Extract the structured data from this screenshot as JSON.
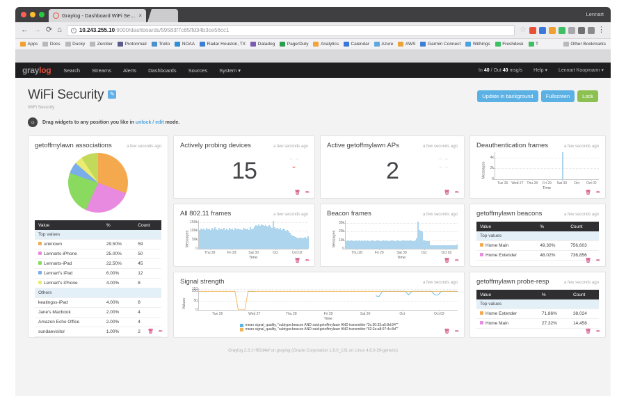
{
  "window": {
    "user": "Lennart"
  },
  "browser": {
    "tab_title": "Graylog - Dashboard WiFi Sec…",
    "tab_close": "×",
    "url_host": "10.243.255.10",
    "url_path": ":9000/dashboards/59583f7c85ffd34b3ce56cc1",
    "back_icon": "←",
    "fwd_icon": "→",
    "reload_icon": "⟳",
    "home_icon": "⌂",
    "star_icon": "☆",
    "menu_icon": "⋮",
    "bookmarks": [
      {
        "label": "Apps",
        "icon": "apps-grid-icon",
        "color": "#f0a030"
      },
      {
        "label": "Docs",
        "icon": "folder-icon",
        "color": "#b9b8bb"
      },
      {
        "label": "Ducky",
        "icon": "folder-icon",
        "color": "#b9b8bb"
      },
      {
        "label": "Zerotier",
        "icon": "folder-icon",
        "color": "#b9b8bb"
      },
      {
        "label": "Protonmail",
        "icon": "lock-icon",
        "color": "#5b5b8c"
      },
      {
        "label": "Trello",
        "icon": "trello-icon",
        "color": "#4c8fce"
      },
      {
        "label": "NOAA",
        "icon": "globe-icon",
        "color": "#2e8fd4"
      },
      {
        "label": "Radar Houston, TX",
        "icon": "radar-icon",
        "color": "#3d7fd0"
      },
      {
        "label": "Datadog",
        "icon": "datadog-icon",
        "color": "#7a5cb0"
      },
      {
        "label": "PagerDuty",
        "icon": "pagerduty-icon",
        "color": "#2a9d4e"
      },
      {
        "label": "Analytics",
        "icon": "analytics-icon",
        "color": "#f2a33c"
      },
      {
        "label": "Calendar",
        "icon": "calendar-icon",
        "color": "#3a78d8"
      },
      {
        "label": "Azure",
        "icon": "cloud-icon",
        "color": "#5fa8dd"
      },
      {
        "label": "AWS",
        "icon": "aws-icon",
        "color": "#e8a33d"
      },
      {
        "label": "Garmin Connect",
        "icon": "triangle-icon",
        "color": "#3d7fd0"
      },
      {
        "label": "Withings",
        "icon": "withings-icon",
        "color": "#4aa3e0"
      },
      {
        "label": "Freshdesk",
        "icon": "freshdesk-icon",
        "color": "#3fbf63"
      },
      {
        "label": "T",
        "icon": "square-icon",
        "color": "#3fbf63"
      }
    ],
    "other_bookmarks": "Other Bookmarks"
  },
  "graylog_nav": {
    "logo_part1": "gray",
    "logo_part2": "log",
    "items": [
      "Search",
      "Streams",
      "Alerts",
      "Dashboards",
      "Sources",
      "System ▾"
    ],
    "throughput_prefix": "In ",
    "in_value": "40",
    "throughput_mid": " / Out ",
    "out_value": "40",
    "throughput_suffix": " msg/s",
    "help": "Help ▾",
    "user": "Lennart Koopmann ▾"
  },
  "page": {
    "title": "WiFi Security",
    "edit_icon": "✎",
    "subtitle": "WiFi Security",
    "hint_pre": "Drag widgets to any position you like in ",
    "hint_link": "unlock / edit",
    "hint_post": " mode.",
    "bulb_icon": "💡",
    "buttons": {
      "update_background": "Update in background",
      "fullscreen": "Fullscreen",
      "lock": "Lock"
    }
  },
  "widget_actions": {
    "delete_icon": "🗑",
    "edit_icon": "✏"
  },
  "widgets": {
    "associations": {
      "title": "getoffmylawn associations",
      "time": "a few seconds ago",
      "headers": [
        "Value",
        "%",
        "Count"
      ],
      "section_top": "Top values",
      "section_others": "Others",
      "top_rows": [
        {
          "value": "unknown",
          "pct": "29.50%",
          "count": "59",
          "color": "#f5a94e"
        },
        {
          "value": "Lennarts-iPhone",
          "pct": "25.00%",
          "count": "50",
          "color": "#e78ae0"
        },
        {
          "value": "Lennarts-iPad",
          "pct": "22.50%",
          "count": "45",
          "color": "#8ada5f"
        },
        {
          "value": "Lennart's iPad",
          "pct": "6.00%",
          "count": "12",
          "color": "#7aaeea"
        },
        {
          "value": "Lennart's iPhone",
          "pct": "4.00%",
          "count": "8",
          "color": "#e9ec70"
        }
      ],
      "other_rows": [
        {
          "value": "keatingss-iPad",
          "pct": "4.00%",
          "count": "8"
        },
        {
          "value": "Jane's Macbook",
          "pct": "2.00%",
          "count": "4"
        },
        {
          "value": "Amazon Echo Office",
          "pct": "2.00%",
          "count": "4"
        },
        {
          "value": "sundaevisitor",
          "pct": "1.00%",
          "count": "2"
        }
      ]
    },
    "probing": {
      "title": "Actively probing devices",
      "time": "a few seconds ago",
      "value": "15",
      "trend_up_icon": "⌃⌃",
      "trend_down_icon": "⌄"
    },
    "aps": {
      "title": "Active getoffmylawn APs",
      "time": "a few seconds ago",
      "value": "2",
      "trend_up_icon": "⌃⌃",
      "trend_down_icon": "⌄⌄"
    },
    "deauth": {
      "title": "Deauthentication frames",
      "time": "a few seconds ago"
    },
    "all_frames": {
      "title": "All 802.11 frames",
      "time": "a few seconds ago"
    },
    "beacon_frames": {
      "title": "Beacon frames",
      "time": "a few seconds ago"
    },
    "beacons_table": {
      "title": "getoffmylawn beacons",
      "time": "a few seconds ago",
      "headers": [
        "Value",
        "%",
        "Count"
      ],
      "section_top": "Top values",
      "rows": [
        {
          "value": "Home Main",
          "pct": "49.30%",
          "count": "756,603",
          "color": "#f5a94e"
        },
        {
          "value": "Home Extender",
          "pct": "48.02%",
          "count": "736,856",
          "color": "#e78ae0"
        }
      ]
    },
    "probe_resp_table": {
      "title": "getoffmylawn probe-resp",
      "time": "a few seconds ago",
      "headers": [
        "Value",
        "%",
        "Count"
      ],
      "section_top": "Top values",
      "rows": [
        {
          "value": "Home Extender",
          "pct": "71.86%",
          "count": "38,024",
          "color": "#f5a94e"
        },
        {
          "value": "Home Main",
          "pct": "27.32%",
          "count": "14,458",
          "color": "#e78ae0"
        }
      ]
    },
    "signal": {
      "title": "Signal strength",
      "time": "a few seconds ago",
      "legend": [
        {
          "label": "mean signal_quality, \"subtype:beacon AND ssid:getoffmylawn AND transmitter:\"2c:30:33:a5:8d:94\"\"",
          "color": "#5bb4e5"
        },
        {
          "label": "mean signal_quality, \"subtype:beacon AND ssid:getoffmylawn AND transmitter:\"62:2a:a8:07:4c:8d\"\"",
          "color": "#f0b252"
        }
      ]
    }
  },
  "footer": "Graylog 2.3.1+9f2d4ef on graylog (Oracle Corporation 1.8.0_131 on Linux 4.8.0-39-generic)",
  "chart_data": [
    {
      "type": "area",
      "name": "deauthentication-frames",
      "title": "Deauthentication frames",
      "xlabel": "Time",
      "ylabel": "Messages",
      "yticks": [
        "0",
        "2k",
        "4k"
      ],
      "ylim": [
        0,
        5000
      ],
      "xticks": [
        "Tue 26",
        "Wed 27",
        "Thu 28",
        "Fri 29",
        "Sat 30",
        "Oct",
        "Oct 02"
      ],
      "grid": true,
      "color": "#aed5ee",
      "values": [
        0,
        0,
        0,
        0,
        0,
        0,
        0,
        0,
        0,
        0,
        0,
        0,
        0,
        0,
        0,
        0,
        0,
        0,
        0,
        0,
        0,
        0,
        0,
        0,
        0,
        0,
        0,
        0,
        0,
        0,
        0,
        0,
        0,
        0,
        0,
        0,
        0,
        0,
        0,
        0,
        0,
        0,
        0,
        0,
        0,
        4950,
        0,
        0,
        0,
        0,
        0,
        0,
        0,
        0,
        0,
        0,
        0,
        0,
        0,
        0,
        0,
        0,
        0,
        0,
        0,
        0,
        0,
        0,
        0,
        0
      ]
    },
    {
      "type": "area",
      "name": "all-802-11-frames",
      "title": "All 802.11 frames",
      "xlabel": "Time",
      "ylabel": "Messages",
      "yticks": [
        "0",
        "50k",
        "100k",
        "150k"
      ],
      "ylim": [
        0,
        160000
      ],
      "xticks": [
        "Thu 28",
        "Fri 29",
        "Sat 30",
        "Oct",
        "Oct 02"
      ],
      "grid": true,
      "color": "#aed5ee",
      "values": [
        104000,
        112000,
        108000,
        115000,
        106000,
        118000,
        110000,
        113000,
        107000,
        116000,
        109000,
        120000,
        111000,
        105000,
        117000,
        108000,
        114000,
        110000,
        119000,
        106000,
        112000,
        107000,
        116000,
        109000,
        113000,
        105000,
        118000,
        110000,
        115000,
        108000,
        111000,
        106000,
        117000,
        112000,
        109000,
        114000,
        107000,
        120000,
        110000,
        113000,
        125000,
        133000,
        128000,
        136000,
        130000,
        138000,
        132000,
        127000,
        135000,
        129000,
        124000,
        131000,
        126000,
        119000,
        155000,
        121000,
        113000,
        118000,
        110000,
        116000,
        105000,
        112000,
        108000,
        100000,
        104000,
        96000,
        88000,
        80000,
        74000,
        70000,
        66000,
        62000,
        58000,
        61000,
        64000,
        59000,
        63000,
        67000,
        60000,
        72000
      ]
    },
    {
      "type": "area",
      "name": "beacon-frames",
      "title": "Beacon frames",
      "xlabel": "Time",
      "ylabel": "Messages",
      "yticks": [
        "0",
        "10k",
        "20k",
        "30k"
      ],
      "ylim": [
        0,
        33000
      ],
      "xticks": [
        "Thu 28",
        "Fri 29",
        "Sat 30",
        "Oct",
        "Oct 02"
      ],
      "grid": true,
      "color": "#aed5ee",
      "values": [
        9200,
        9400,
        9100,
        9300,
        9500,
        9200,
        9000,
        9400,
        9200,
        9300,
        9100,
        9500,
        9200,
        9300,
        9000,
        9400,
        9200,
        9100,
        9300,
        9500,
        9200,
        9000,
        9400,
        9300,
        9100,
        9200,
        9500,
        9300,
        9000,
        9400,
        9200,
        9100,
        9300,
        9400,
        9200,
        9000,
        9500,
        9300,
        9100,
        9200,
        9400,
        9300,
        9100,
        9500,
        9200,
        9400,
        9300,
        9100,
        9200,
        9500,
        12000,
        31500,
        22000,
        21000,
        20500,
        9800,
        9300,
        9200,
        9100,
        9000,
        4200,
        4000,
        4300,
        4100,
        4200,
        4000,
        4400,
        4100,
        4300,
        4200,
        4000,
        4300,
        4100,
        4200,
        4400,
        4100,
        4300,
        4200,
        4000,
        4500
      ]
    },
    {
      "type": "line",
      "name": "signal-strength",
      "title": "Signal strength",
      "xlabel": "Time",
      "ylabel": "Values",
      "yticks": [
        "0",
        "50",
        "100",
        "110"
      ],
      "ylim": [
        0,
        115
      ],
      "xticks": [
        "Tue 26",
        "Wed 27",
        "Thu 28",
        "Fri 29",
        "Sat 30",
        "Oct",
        "Oct 02"
      ],
      "grid": true,
      "series": [
        {
          "name": "2c:30:33:a5:8d:94",
          "color": "#5bb4e5",
          "values": [
            null,
            null,
            null,
            null,
            null,
            null,
            null,
            null,
            null,
            null,
            null,
            null,
            null,
            null,
            null,
            99,
            99,
            99,
            null,
            null,
            null,
            null,
            null,
            null,
            null,
            null,
            null,
            null,
            null,
            null,
            null,
            null,
            null,
            null,
            null,
            null,
            null,
            null,
            null,
            null,
            null,
            null,
            null,
            null,
            null,
            null,
            null,
            null,
            null,
            null,
            null,
            null,
            null,
            null,
            75,
            72,
            99,
            99,
            99,
            99,
            99,
            99,
            99,
            99,
            80,
            99,
            99,
            99,
            99,
            99,
            99,
            99,
            80,
            80,
            99,
            99,
            99,
            99,
            99,
            99
          ]
        },
        {
          "name": "62:2a:a8:07:4c:8d",
          "color": "#f0b252",
          "values": [
            99,
            99,
            99,
            99,
            99,
            99,
            99,
            99,
            99,
            99,
            99,
            99,
            0,
            0,
            0,
            99,
            99,
            99,
            99,
            99,
            99,
            99,
            99,
            99,
            99,
            99,
            99,
            99,
            99,
            99,
            99,
            99,
            99,
            99,
            99,
            99,
            99,
            99,
            99,
            99,
            99,
            99,
            99,
            99,
            99,
            99,
            99,
            99,
            99,
            99,
            99,
            99,
            99,
            99,
            99,
            99,
            99,
            99,
            99,
            99,
            99,
            99,
            99,
            99,
            99,
            99,
            99,
            99,
            99,
            99,
            99,
            99,
            99,
            99,
            99,
            99,
            99,
            99,
            99,
            99
          ]
        }
      ]
    },
    {
      "type": "pie",
      "name": "getoffmylawn-associations-pie",
      "title": "getoffmylawn associations",
      "labels": [
        "unknown",
        "Lennarts-iPhone",
        "Lennarts-iPad",
        "Lennart's iPad",
        "Lennart's iPhone",
        "Others"
      ],
      "values": [
        29.5,
        25.0,
        22.5,
        6.0,
        4.0,
        9.0
      ],
      "colors": [
        "#f5a94e",
        "#e78ae0",
        "#8ada5f",
        "#7aaeea",
        "#e9ec70",
        "#c3d95a"
      ]
    }
  ]
}
